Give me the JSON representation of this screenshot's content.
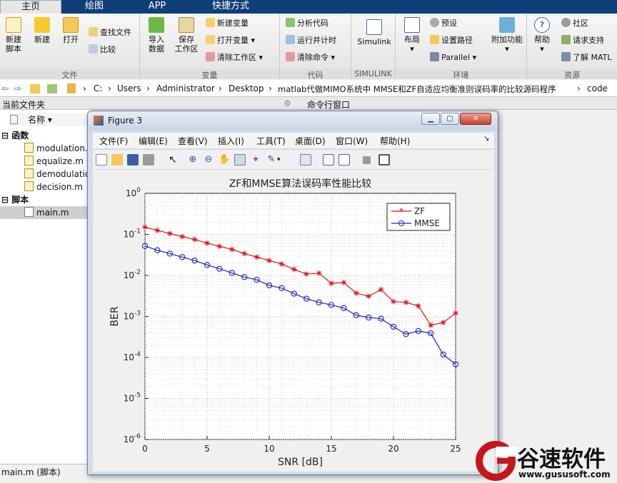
{
  "tabs": [
    "主页",
    "绘图",
    "APP",
    "快捷方式"
  ],
  "ribbon": {
    "file": {
      "label": "文件",
      "new_script": "新建\n脚本",
      "new": "新建",
      "open": "打开",
      "find_files": "查找文件",
      "compare": "比较"
    },
    "variable": {
      "label": "变量",
      "import_data": "导入\n数据",
      "save_workspace": "保存\n工作区",
      "new_variable": "新建变量",
      "open_variable": "打开变量",
      "clear_workspace": "清除工作区"
    },
    "code": {
      "label": "代码",
      "analyze_code": "分析代码",
      "run_and_time": "运行并计时",
      "clear_commands": "清除命令"
    },
    "simulink": {
      "label": "SIMULINK",
      "simulink": "Simulink"
    },
    "environment": {
      "label": "环境",
      "layout": "布局",
      "preferences": "预设",
      "set_path": "设置路径",
      "parallel": "Parallel",
      "addons": "附加功能"
    },
    "resources": {
      "label": "资源",
      "help": "帮助",
      "community": "社区",
      "request_support": "请求支持",
      "learn_matlab": "了解 MATL"
    }
  },
  "address": {
    "crumbs": [
      "C:",
      "Users",
      "Administrator",
      "Desktop",
      "matlab代做MIMO系统中 MMSE和ZF自适应均衡准则误码率的比较源码程序",
      "code"
    ]
  },
  "panels": {
    "current_folder": "当前文件夹",
    "command_window": "命令行窗口",
    "name_column": "名称"
  },
  "tree": {
    "group_functions": "函数",
    "functions": [
      "modulation.m",
      "equalize.m",
      "demodulation.m",
      "decision.m"
    ],
    "group_scripts": "脚本",
    "scripts": [
      "main.m"
    ]
  },
  "status_bar": "main.m  (脚本)",
  "figure": {
    "title": "Figure 3",
    "menu": [
      "文件(F)",
      "编辑(E)",
      "查看(V)",
      "插入(I)",
      "工具(T)",
      "桌面(D)",
      "窗口(W)",
      "帮助(H)"
    ]
  },
  "watermark": {
    "brand": "谷速软件",
    "url": "www.gususoft.com"
  },
  "chart_data": {
    "type": "line",
    "title": "ZF和MMSE算法误码率性能比较",
    "xlabel": "SNR [dB]",
    "ylabel": "BER",
    "xlim": [
      0,
      25
    ],
    "ylim": [
      1e-06,
      1
    ],
    "yscale": "log",
    "xticks": [
      0,
      5,
      10,
      15,
      20,
      25
    ],
    "yticks": [
      "10^0",
      "10^-1",
      "10^-2",
      "10^-3",
      "10^-4",
      "10^-5",
      "10^-6"
    ],
    "grid": true,
    "legend_position": "top-right",
    "x": [
      0,
      1,
      2,
      3,
      4,
      5,
      6,
      7,
      8,
      9,
      10,
      11,
      12,
      13,
      14,
      15,
      16,
      17,
      18,
      19,
      20,
      21,
      22,
      23,
      24,
      25
    ],
    "series": [
      {
        "name": "ZF",
        "color": "#e0141a",
        "marker": "star",
        "values": [
          0.15,
          0.125,
          0.105,
          0.088,
          0.075,
          0.061,
          0.051,
          0.043,
          0.034,
          0.028,
          0.023,
          0.019,
          0.014,
          0.0108,
          0.0113,
          0.0064,
          0.0067,
          0.0037,
          0.0031,
          0.0045,
          0.0023,
          0.0022,
          0.0018,
          0.00061,
          0.00071,
          0.0012
        ]
      },
      {
        "name": "MMSE",
        "color": "#1a20c8",
        "marker": "circle",
        "values": [
          0.052,
          0.041,
          0.034,
          0.028,
          0.023,
          0.018,
          0.0145,
          0.0115,
          0.0091,
          0.0078,
          0.0057,
          0.0049,
          0.0036,
          0.0027,
          0.0022,
          0.0019,
          0.0016,
          0.00107,
          0.00094,
          0.00088,
          0.00056,
          0.00037,
          0.00044,
          0.00039,
          0.000118,
          6.8e-05
        ]
      }
    ]
  },
  "colors": {
    "tabbar": "#0f3f78",
    "zf": "#e0141a",
    "mmse": "#1a20c8",
    "watermark": "#c4161c"
  }
}
